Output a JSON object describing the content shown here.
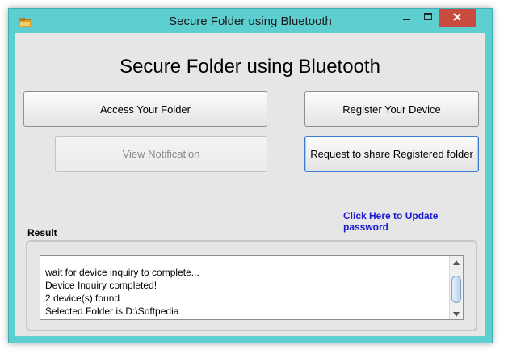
{
  "window": {
    "title": "Secure Folder using Bluetooth"
  },
  "main": {
    "heading": "Secure Folder using Bluetooth",
    "buttons": {
      "access": "Access Your Folder",
      "register": "Register Your Device",
      "view_notification": "View Notification",
      "request_share": "Request to share Registered folder"
    },
    "update_link": "Click Here to Update password",
    "result_label": "Result",
    "log_lines": [
      "wait for device inquiry to complete...",
      "Device Inquiry completed!",
      "2 device(s) found",
      "Selected Folder is D:\\Softpedia"
    ]
  },
  "colors": {
    "frame": "#5ecfd0",
    "close_button": "#c94b3f",
    "link": "#1b1bd3",
    "client_bg": "#e6e6e6"
  },
  "icons": [
    "app-folder-icon",
    "minimize-icon",
    "maximize-icon",
    "close-icon",
    "scroll-up-icon",
    "scroll-down-icon"
  ]
}
